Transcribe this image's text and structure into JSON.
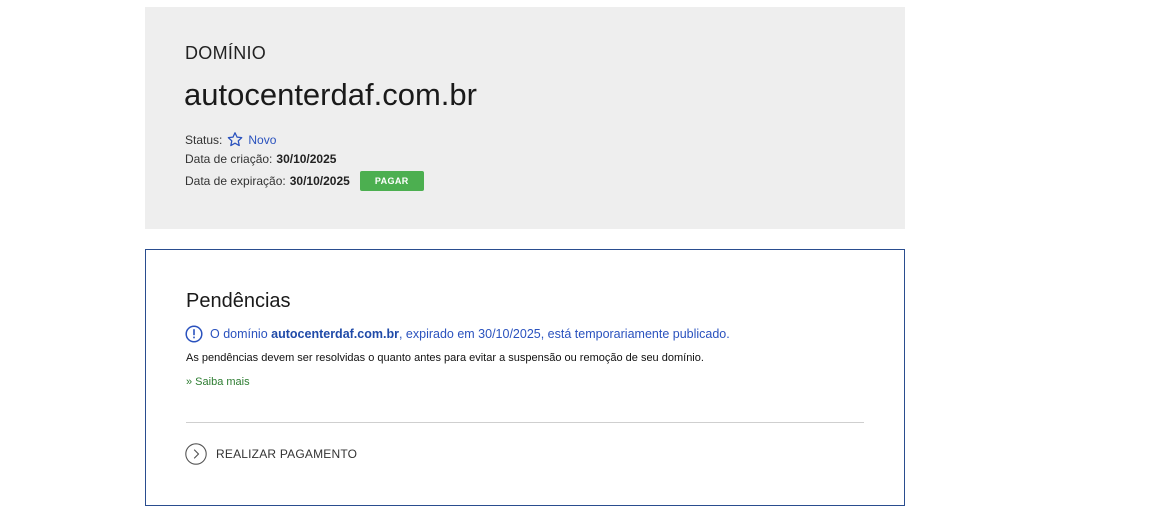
{
  "domain": {
    "label": "DOMÍNIO",
    "name": "autocenterdaf.com.br",
    "status_label": "Status:",
    "status_value": "Novo",
    "status_icon": "star-icon",
    "created_label": "Data de criação:",
    "created_value": "30/10/2025",
    "expire_label": "Data de expiração:",
    "expire_value": "30/10/2025",
    "pay_button": "PAGAR"
  },
  "pendencias": {
    "title": "Pendências",
    "alert_icon": "alert-circle-icon",
    "alert_prefix": "O domínio",
    "alert_domain": "autocenterdaf.com.br",
    "alert_suffix": ", expirado em 30/10/2025, está temporariamente publicado.",
    "note": "As pendências devem ser resolvidas o quanto antes para evitar a suspensão ou remoção de seu domínio.",
    "more_link": "» Saiba mais",
    "action_icon": "chevron-right-circle-icon",
    "action_label": "REALIZAR PAGAMENTO"
  },
  "colors": {
    "panel_bg": "#eeeeee",
    "accent_blue": "#2a52be",
    "pay_green": "#4caf50",
    "link_green": "#2e7d32",
    "box_border": "#2a4d8f"
  }
}
